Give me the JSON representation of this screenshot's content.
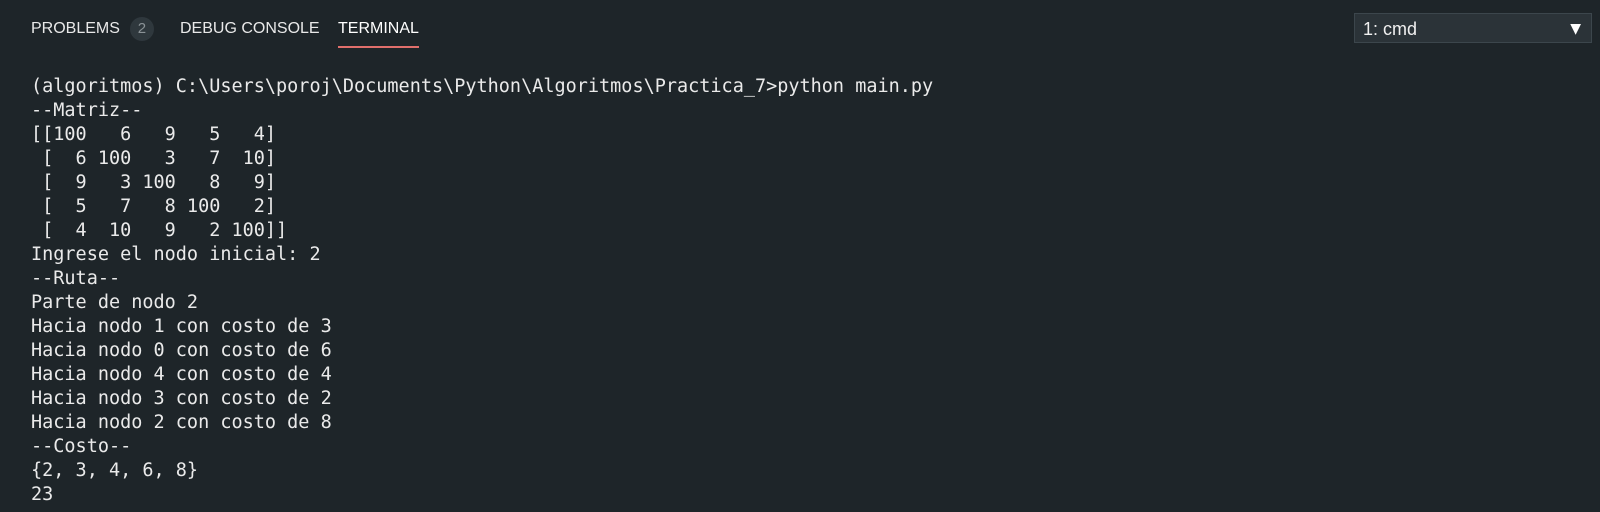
{
  "tabs": {
    "problems": {
      "label": "PROBLEMS",
      "count": "2"
    },
    "debug_console": {
      "label": "DEBUG CONSOLE"
    },
    "terminal": {
      "label": "TERMINAL",
      "active": true
    }
  },
  "terminal_select": {
    "value": "1: cmd",
    "caret": "▼"
  },
  "terminal_lines": [
    "(algoritmos) C:\\Users\\poroj\\Documents\\Python\\Algoritmos\\Practica_7>python main.py",
    "--Matriz--",
    "[[100   6   9   5   4]",
    " [  6 100   3   7  10]",
    " [  9   3 100   8   9]",
    " [  5   7   8 100   2]",
    " [  4  10   9   2 100]]",
    "Ingrese el nodo inicial: 2",
    "--Ruta--",
    "Parte de nodo 2",
    "Hacia nodo 1 con costo de 3",
    "Hacia nodo 0 con costo de 6",
    "Hacia nodo 4 con costo de 4",
    "Hacia nodo 3 con costo de 2",
    "Hacia nodo 2 con costo de 8",
    "--Costo--",
    "{2, 3, 4, 6, 8}",
    "23"
  ],
  "colors": {
    "background": "#1e2529",
    "active_tab_underline": "#e06f6c",
    "text": "#eaeaea"
  }
}
